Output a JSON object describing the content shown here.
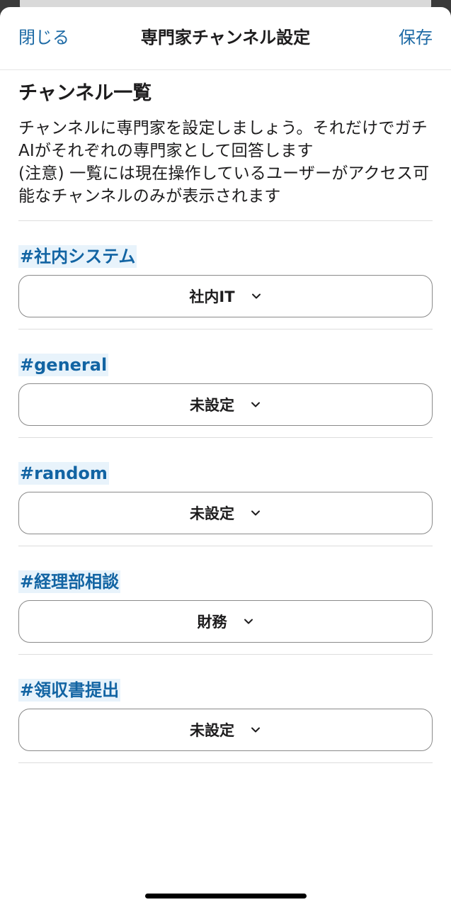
{
  "header": {
    "close_label": "閉じる",
    "title": "専門家チャンネル設定",
    "save_label": "保存"
  },
  "section": {
    "heading": "チャンネル一覧",
    "description": "チャンネルに専門家を設定しましょう。それだけでガチAIがそれぞれの専門家として回答します\n(注意) 一覧には現在操作しているユーザーがアクセス可能なチャンネルのみが表示されます"
  },
  "channels": [
    {
      "name": "#社内システム",
      "selected": "社内IT"
    },
    {
      "name": "#general",
      "selected": "未設定"
    },
    {
      "name": "#random",
      "selected": "未設定"
    },
    {
      "name": "#経理部相談",
      "selected": "財務"
    },
    {
      "name": "#領収書提出",
      "selected": "未設定"
    }
  ],
  "colors": {
    "accent": "#1d6aa5",
    "channel_text": "#1264a3",
    "channel_highlight": "#e8f3fb"
  }
}
